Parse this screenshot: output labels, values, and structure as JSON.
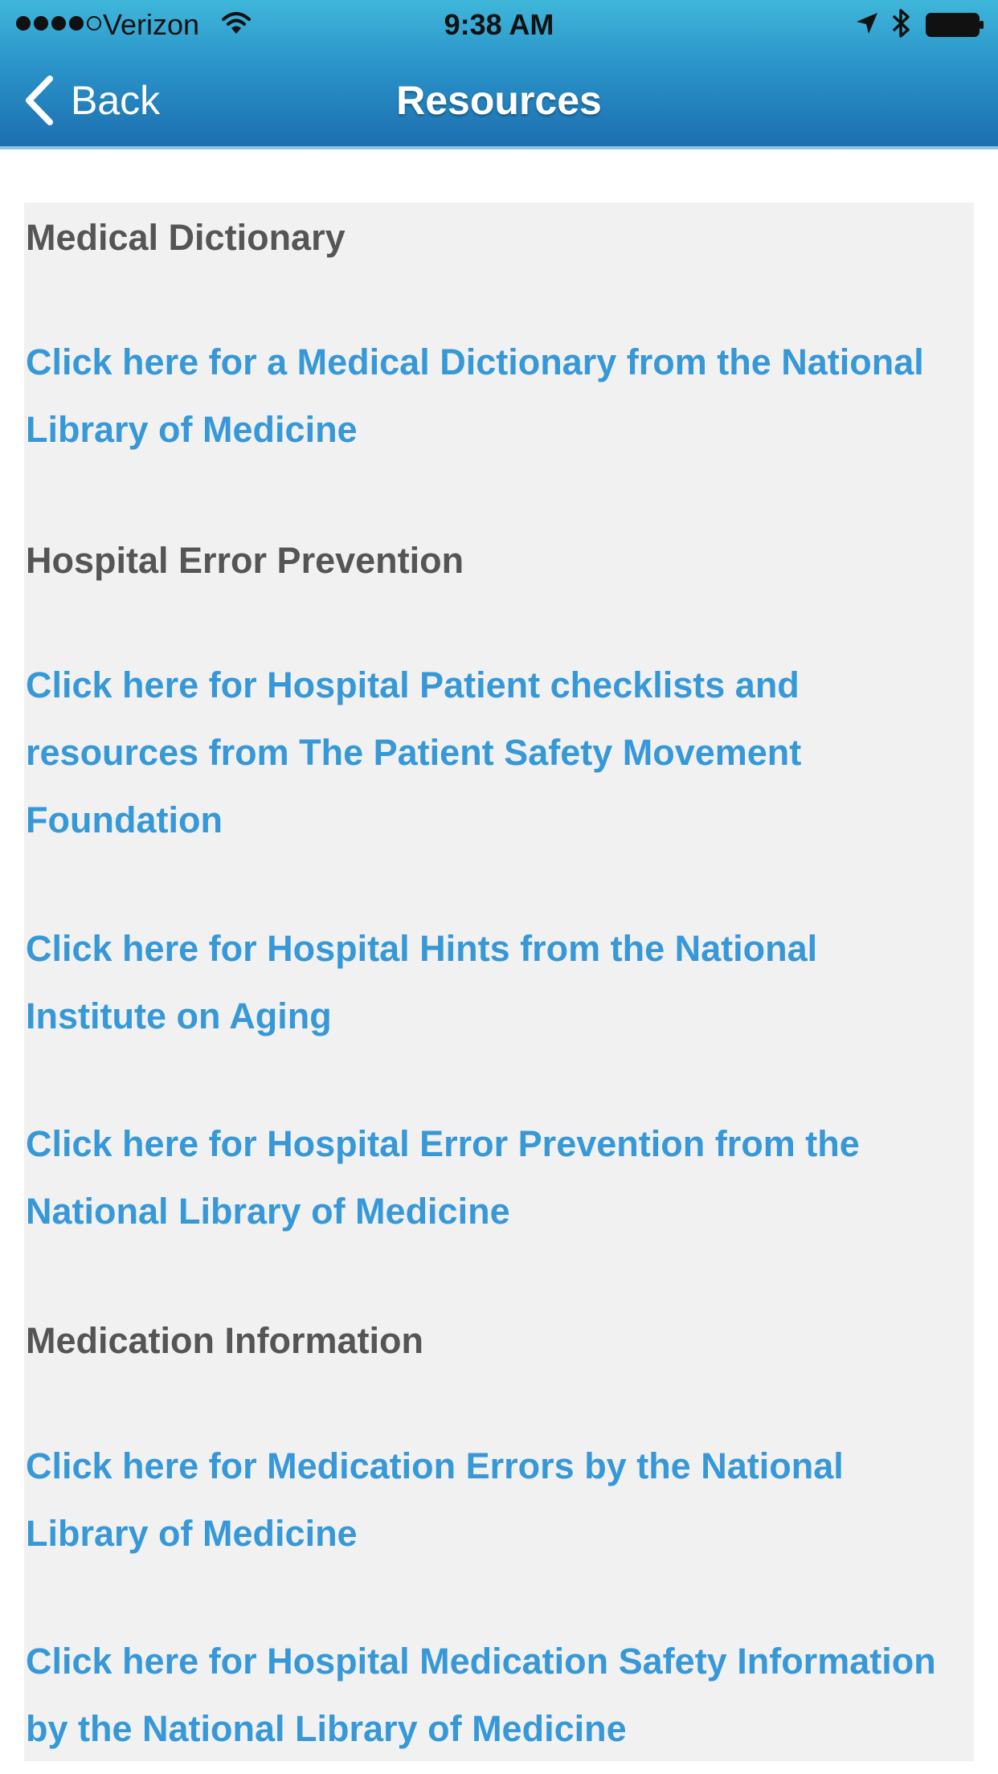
{
  "status_bar": {
    "carrier": "Verizon",
    "time": "9:38 AM",
    "signal_icon": "signal-strength-icon",
    "wifi_icon": "wifi-icon",
    "location_icon": "location-arrow-icon",
    "bluetooth_icon": "bluetooth-icon",
    "battery_icon": "battery-icon"
  },
  "nav": {
    "back_label": "Back",
    "title": "Resources"
  },
  "colors": {
    "header": "#2a93c9",
    "link": "#3798d8",
    "heading": "#555555",
    "content_bg": "#f1f1f2"
  },
  "sections": [
    {
      "heading": "Medical Dictionary"
    },
    {
      "heading": "Hospital Error Prevention"
    },
    {
      "heading": "Medication Information"
    }
  ],
  "links": [
    {
      "label": "Click here for a Medical Dictionary from the National Library of Medicine"
    },
    {
      "label": "Click here for Hospital Patient checklists and resources from The Patient Safety Movement Foundation"
    },
    {
      "label": "Click here for Hospital Hints from the National Institute on Aging"
    },
    {
      "label": "Click here for Hospital Error Prevention from the National Library of Medicine"
    },
    {
      "label": "Click here for Medication Errors by the National Library of Medicine"
    },
    {
      "label": "Click here for Hospital Medication Safety Information by the National Library of Medicine"
    }
  ]
}
